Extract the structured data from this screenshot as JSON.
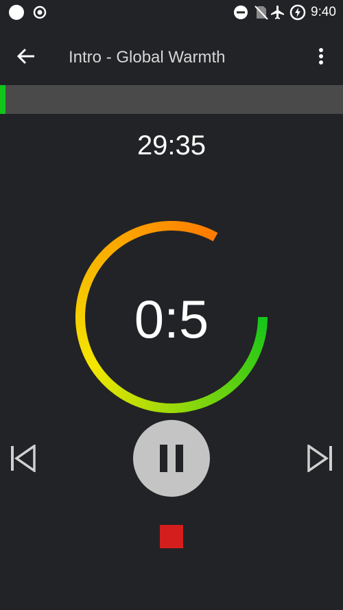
{
  "status_bar": {
    "time": "9:40",
    "icons": [
      "notification-dot-icon",
      "target-icon",
      "do-not-disturb-icon",
      "no-sim-icon",
      "airplane-mode-icon",
      "battery-charging-icon"
    ]
  },
  "app_bar": {
    "back_icon": "arrow-back-icon",
    "title": "Intro - Global Warmth",
    "menu_icon": "more-vertical-icon"
  },
  "workout_progress": {
    "fraction_complete": 0.016,
    "fill_color": "#12c51a",
    "track_color": "#4a4a4a"
  },
  "timer": {
    "total_remaining": "29:35",
    "interval_remaining": "0:5",
    "ring_fraction_remaining": 0.83,
    "ring_gradient": [
      "#ff7a00",
      "#f4e600",
      "#12c51a"
    ]
  },
  "controls": {
    "previous_icon": "skip-previous-icon",
    "pause_icon": "pause-icon",
    "next_icon": "skip-next-icon",
    "stop_icon": "stop-icon",
    "stop_color": "#d41e1e"
  }
}
